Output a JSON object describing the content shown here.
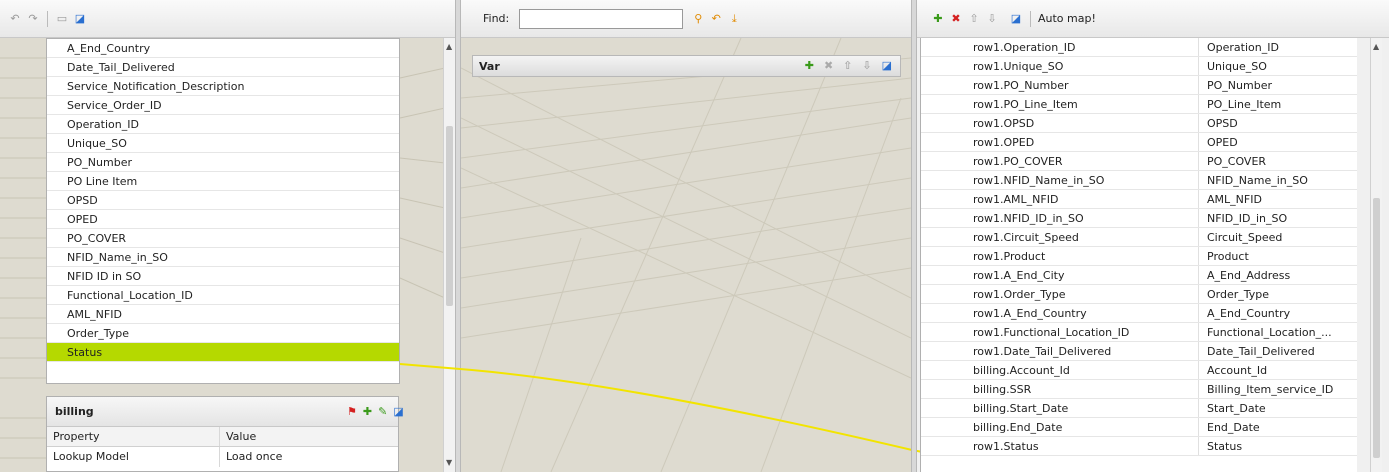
{
  "left_toolbar": {
    "icons": [
      "undo-icon",
      "redo-icon",
      "split-view-icon",
      "auto-layout-icon"
    ]
  },
  "left_list": {
    "items": [
      "A_End_Country",
      "Date_Tail_Delivered",
      "Service_Notification_Description",
      "Service_Order_ID",
      "Operation_ID",
      "Unique_SO",
      "PO_Number",
      "PO Line Item",
      "OPSD",
      "OPED",
      "PO_COVER",
      "NFID_Name_in_SO",
      "NFID ID in SO",
      "Functional_Location_ID",
      "AML_NFID",
      "Order_Type",
      "Status"
    ],
    "selected_index": 16
  },
  "billing": {
    "title": "billing",
    "prop_header": {
      "property": "Property",
      "value": "Value"
    },
    "rows": [
      {
        "property": "Lookup Model",
        "value": "Load once"
      }
    ]
  },
  "find": {
    "label": "Find:",
    "value": ""
  },
  "var_panel": {
    "title": "Var"
  },
  "right_toolbar": {
    "auto_map_label": "Auto map!"
  },
  "right_table": {
    "rows": [
      [
        "row1.Operation_ID",
        "Operation_ID"
      ],
      [
        "row1.Unique_SO",
        "Unique_SO"
      ],
      [
        "row1.PO_Number",
        "PO_Number"
      ],
      [
        "row1.PO_Line_Item",
        "PO_Line_Item"
      ],
      [
        "row1.OPSD",
        "OPSD"
      ],
      [
        "row1.OPED",
        "OPED"
      ],
      [
        "row1.PO_COVER",
        "PO_COVER"
      ],
      [
        "row1.NFID_Name_in_SO",
        "NFID_Name_in_SO"
      ],
      [
        "row1.AML_NFID",
        "AML_NFID"
      ],
      [
        "row1.NFID_ID_in_SO",
        "NFID_ID_in_SO"
      ],
      [
        "row1.Circuit_Speed",
        "Circuit_Speed"
      ],
      [
        "row1.Product",
        "Product"
      ],
      [
        "row1.A_End_City",
        "A_End_Address"
      ],
      [
        "row1.Order_Type",
        "Order_Type"
      ],
      [
        "row1.A_End_Country",
        "A_End_Country"
      ],
      [
        "row1.Functional_Location_ID",
        "Functional_Location_..."
      ],
      [
        "row1.Date_Tail_Delivered",
        "Date_Tail_Delivered"
      ],
      [
        "billing.Account_Id",
        "Account_Id"
      ],
      [
        "billing.SSR",
        "Billing_Item_service_ID"
      ],
      [
        "billing.Start_Date",
        "Start_Date"
      ],
      [
        "billing.End_Date",
        "End_Date"
      ],
      [
        "row1.Status",
        "Status"
      ]
    ]
  },
  "colors": {
    "selection": "#b5d900",
    "link_line": "#f2e400"
  }
}
